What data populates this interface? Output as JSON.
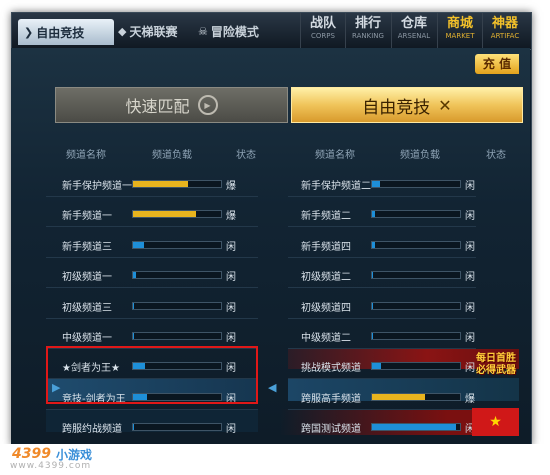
{
  "tabs": [
    {
      "label": "自由竞技",
      "icon": "v-logo-icon",
      "active": true
    },
    {
      "label": "天梯联赛",
      "icon": "ladder-emblem-icon",
      "active": false
    },
    {
      "label": "冒险模式",
      "icon": "skull-icon",
      "active": false
    }
  ],
  "menu": [
    {
      "cn": "战队",
      "en": "CORPS"
    },
    {
      "cn": "排行",
      "en": "RANKING"
    },
    {
      "cn": "仓库",
      "en": "ARSENAL"
    },
    {
      "cn": "商城",
      "en": "MARKET"
    },
    {
      "cn": "神器",
      "en": "ARTIFAC"
    }
  ],
  "charge_label": "充 值",
  "modes": {
    "quick": "快速匹配",
    "free": "自由竞技"
  },
  "headers": {
    "left": {
      "name": "频道名称",
      "load": "频道负载",
      "status": "状态"
    },
    "right": {
      "name": "频道名称",
      "load": "频道负载",
      "status": "状态"
    }
  },
  "left_channels": [
    {
      "name": "新手保护频道一",
      "load": 0.63,
      "color": "#e8b41e",
      "status": "爆"
    },
    {
      "name": "新手频道一",
      "load": 0.72,
      "color": "#e8b41e",
      "status": "爆"
    },
    {
      "name": "新手频道三",
      "load": 0.12,
      "color": "#1e8fd8",
      "status": "闲"
    },
    {
      "name": "初级频道一",
      "load": 0.03,
      "color": "#1e8fd8",
      "status": "闲"
    },
    {
      "name": "初级频道三",
      "load": 0.0,
      "color": "#1e8fd8",
      "status": "闲"
    },
    {
      "name": "中级频道一",
      "load": 0.0,
      "color": "#1e8fd8",
      "status": "闲"
    },
    {
      "name": "★剑者为王★",
      "load": 0.14,
      "color": "#1e8fd8",
      "status": "闲"
    },
    {
      "name": "竞技-剑者为王",
      "load": 0.16,
      "color": "#1e8fd8",
      "status": "闲"
    },
    {
      "name": "跨服约战频道",
      "load": 0.0,
      "color": "#1e8fd8",
      "status": "闲"
    }
  ],
  "right_channels": [
    {
      "name": "新手保护频道二",
      "load": 0.09,
      "color": "#1e8fd8",
      "status": "闲"
    },
    {
      "name": "新手频道二",
      "load": 0.02,
      "color": "#1e8fd8",
      "status": "闲"
    },
    {
      "name": "新手频道四",
      "load": 0.02,
      "color": "#1e8fd8",
      "status": "闲"
    },
    {
      "name": "初级频道二",
      "load": 0.0,
      "color": "#1e8fd8",
      "status": "闲"
    },
    {
      "name": "初级频道四",
      "load": 0.0,
      "color": "#1e8fd8",
      "status": "闲"
    },
    {
      "name": "中级频道二",
      "load": 0.0,
      "color": "#1e8fd8",
      "status": "闲"
    },
    {
      "name": "挑战模式频道",
      "load": 0.1,
      "color": "#1e8fd8",
      "status": "闲"
    },
    {
      "name": "跨服高手频道",
      "load": 0.6,
      "color": "#e8b41e",
      "status": "爆"
    },
    {
      "name": "跨国测试频道",
      "load": 0.95,
      "color": "#1e8fd8",
      "status": "闲"
    }
  ],
  "promo": {
    "line1": "每日首胜",
    "line2": "必得武器"
  },
  "watermark": {
    "brand": "4399",
    "game": "小游戏",
    "url": "www.4399.com"
  }
}
